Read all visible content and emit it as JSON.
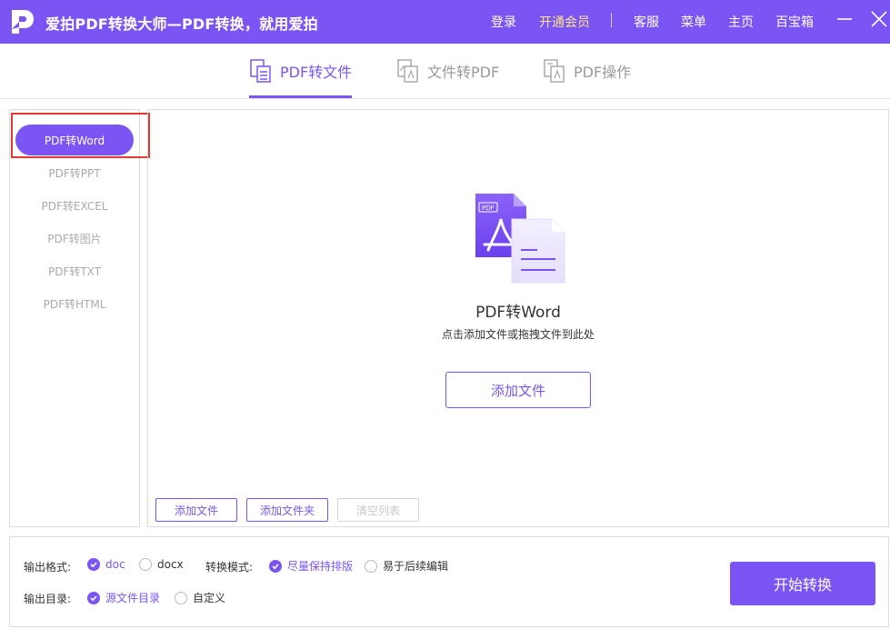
{
  "app": {
    "title": "爱拍PDF转换大师—PDF转换，就用爱拍",
    "accent": "#7a55f4"
  },
  "topnav": {
    "login": "登录",
    "vip": "开通会员",
    "service": "客服",
    "menu": "菜单",
    "home": "主页",
    "toolbox": "百宝箱"
  },
  "tabs": [
    {
      "label": "PDF转文件",
      "active": true,
      "icon": "pdf-to-file-icon"
    },
    {
      "label": "文件转PDF",
      "active": false,
      "icon": "file-to-pdf-icon"
    },
    {
      "label": "PDF操作",
      "active": false,
      "icon": "pdf-operations-icon"
    }
  ],
  "sidebar": {
    "items": [
      {
        "label": "PDF转Word",
        "active": true
      },
      {
        "label": "PDF转PPT",
        "active": false
      },
      {
        "label": "PDF转EXCEL",
        "active": false
      },
      {
        "label": "PDF转图片",
        "active": false
      },
      {
        "label": "PDF转TXT",
        "active": false
      },
      {
        "label": "PDF转HTML",
        "active": false
      }
    ]
  },
  "main": {
    "illustration_text": "PDF",
    "title": "PDF转Word",
    "subtitle": "点击添加文件或拖拽文件到此处",
    "add_file": "添加文件",
    "add_file_small": "添加文件",
    "add_folder": "添加文件夹",
    "clear_list": "清空列表"
  },
  "options": {
    "output_format_label": "输出格式:",
    "format_doc": "doc",
    "format_docx": "docx",
    "mode_label": "转换模式:",
    "mode_keep_layout": "尽量保持排版",
    "mode_easy_edit": "易于后续编辑",
    "output_dir_label": "输出目录:",
    "dir_source": "源文件目录",
    "dir_custom": "自定义",
    "start": "开始转换"
  }
}
